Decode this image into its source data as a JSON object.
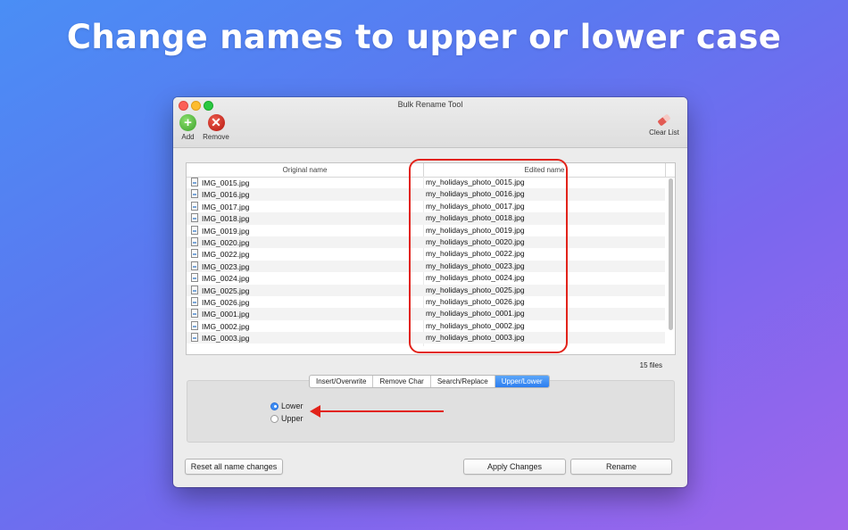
{
  "headline": "Change names to upper or lower case",
  "window": {
    "title": "Bulk Rename Tool"
  },
  "toolbar": {
    "add_label": "Add",
    "remove_label": "Remove",
    "clear_label": "Clear List"
  },
  "table": {
    "columns": {
      "original": "Original name",
      "edited": "Edited name"
    },
    "rows": [
      {
        "original": "IMG_0015.jpg",
        "edited": "my_holidays_photo_0015.jpg"
      },
      {
        "original": "IMG_0016.jpg",
        "edited": "my_holidays_photo_0016.jpg"
      },
      {
        "original": "IMG_0017.jpg",
        "edited": "my_holidays_photo_0017.jpg"
      },
      {
        "original": "IMG_0018.jpg",
        "edited": "my_holidays_photo_0018.jpg"
      },
      {
        "original": "IMG_0019.jpg",
        "edited": "my_holidays_photo_0019.jpg"
      },
      {
        "original": "IMG_0020.jpg",
        "edited": "my_holidays_photo_0020.jpg"
      },
      {
        "original": "IMG_0022.jpg",
        "edited": "my_holidays_photo_0022.jpg"
      },
      {
        "original": "IMG_0023.jpg",
        "edited": "my_holidays_photo_0023.jpg"
      },
      {
        "original": "IMG_0024.jpg",
        "edited": "my_holidays_photo_0024.jpg"
      },
      {
        "original": "IMG_0025.jpg",
        "edited": "my_holidays_photo_0025.jpg"
      },
      {
        "original": "IMG_0026.jpg",
        "edited": "my_holidays_photo_0026.jpg"
      },
      {
        "original": "IMG_0001.jpg",
        "edited": "my_holidays_photo_0001.jpg"
      },
      {
        "original": "IMG_0002.jpg",
        "edited": "my_holidays_photo_0002.jpg"
      },
      {
        "original": "IMG_0003.jpg",
        "edited": "my_holidays_photo_0003.jpg"
      }
    ],
    "file_count": "15 files"
  },
  "tabs": [
    "Insert/Overwrite",
    "Remove Char",
    "Search/Replace",
    "Upper/Lower"
  ],
  "active_tab": "Upper/Lower",
  "options": {
    "lower_label": "Lower",
    "upper_label": "Upper",
    "selected": "Lower"
  },
  "buttons": {
    "reset": "Reset all name changes",
    "apply": "Apply Changes",
    "rename": "Rename"
  },
  "colors": {
    "highlight": "#e2231a",
    "active_tab": "#3a87f4"
  }
}
